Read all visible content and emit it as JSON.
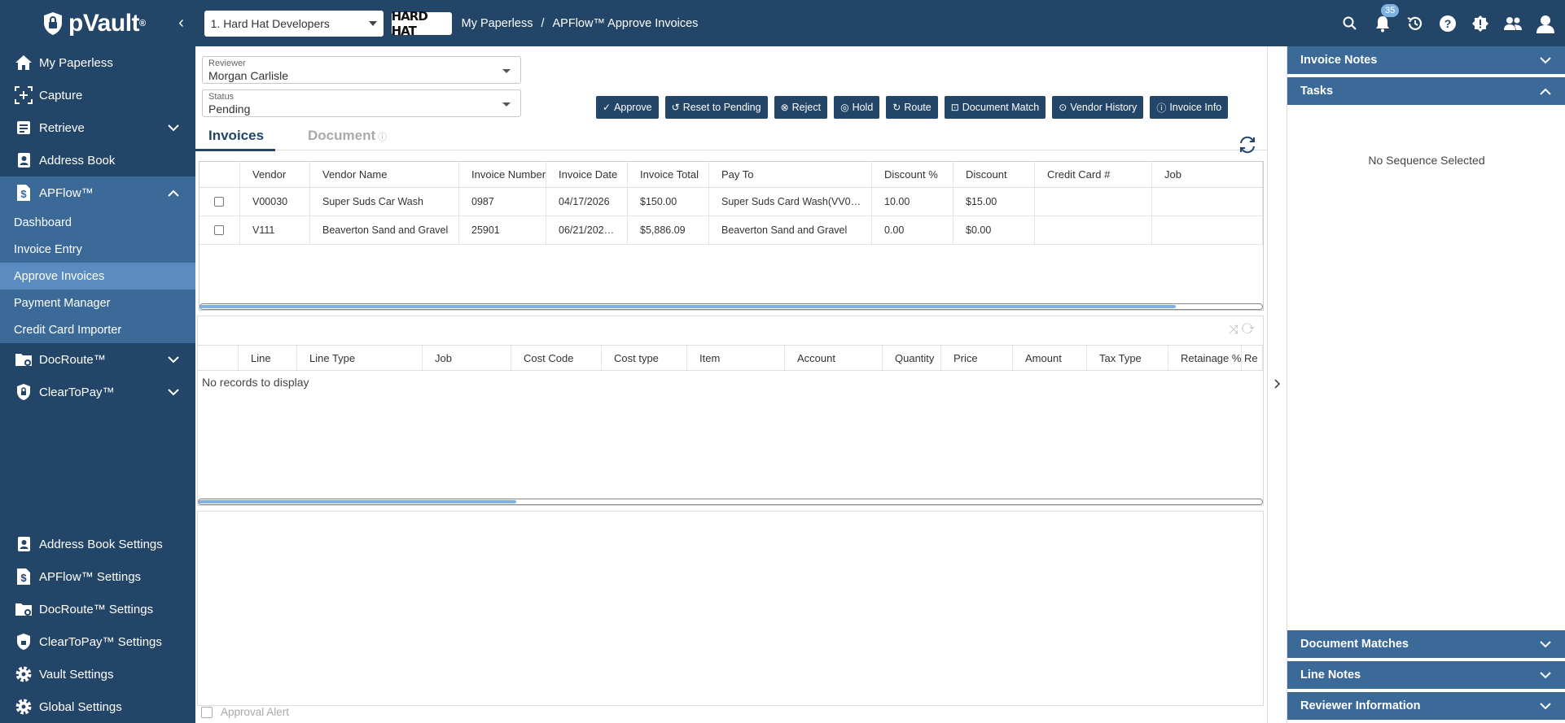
{
  "app": {
    "brand": "pVault",
    "brand_suffix": "®"
  },
  "header": {
    "company_selector": "1. Hard Hat Developers",
    "company_logo_text": "HARD HAT",
    "breadcrumb": [
      "My Paperless",
      "/",
      "APFlow™ Approve Invoices"
    ],
    "notification_count": "35"
  },
  "sidebar": {
    "items": [
      {
        "label": "My Paperless",
        "icon": "home-icon"
      },
      {
        "label": "Capture",
        "icon": "capture-icon"
      },
      {
        "label": "Retrieve",
        "icon": "retrieve-icon"
      },
      {
        "label": "Address Book",
        "icon": "address-book-icon"
      },
      {
        "label": "APFlow™",
        "icon": "dollar-doc-icon"
      }
    ],
    "apflow_sub": [
      "Dashboard",
      "Invoice Entry",
      "Approve Invoices",
      "Payment Manager",
      "Credit Card Importer"
    ],
    "items_after": [
      {
        "label": "DocRoute™",
        "icon": "folder-route-icon"
      },
      {
        "label": "ClearToPay™",
        "icon": "shield-lock-icon"
      }
    ],
    "settings": [
      {
        "label": "Address Book Settings",
        "icon": "address-book-icon"
      },
      {
        "label": "APFlow™ Settings",
        "icon": "dollar-doc-icon"
      },
      {
        "label": "DocRoute™ Settings",
        "icon": "folder-route-icon"
      },
      {
        "label": "ClearToPay™ Settings",
        "icon": "shield-lock-icon"
      },
      {
        "label": "Vault Settings",
        "icon": "gear-icon"
      },
      {
        "label": "Global Settings",
        "icon": "gear-icon"
      }
    ]
  },
  "filters": {
    "reviewer_label": "Reviewer",
    "reviewer_value": "Morgan Carlisle",
    "status_label": "Status",
    "status_value": "Pending"
  },
  "actions": [
    "Approve",
    "Reset to Pending",
    "Reject",
    "Hold",
    "Route",
    "Document Match",
    "Vendor History",
    "Invoice Info"
  ],
  "tabs": {
    "invoices": "Invoices",
    "document": "Document"
  },
  "invoice_table": {
    "columns": [
      "Vendor",
      "Vendor Name",
      "Invoice Number",
      "Invoice Date",
      "Invoice Total",
      "Pay To",
      "Discount %",
      "Discount",
      "Credit Card #",
      "Job"
    ],
    "rows": [
      [
        "V00030",
        "Super Suds Car Wash",
        "0987",
        "04/17/2026",
        "$150.00",
        "Super Suds Card Wash(VV0…",
        "10.00",
        "$15.00",
        "",
        ""
      ],
      [
        "V111",
        "Beaverton Sand and Gravel",
        "25901",
        "06/21/202…",
        "$5,886.09",
        "Beaverton Sand and Gravel",
        "0.00",
        "$0.00",
        "",
        ""
      ]
    ]
  },
  "line_table": {
    "columns": [
      "Line",
      "Line Type",
      "Job",
      "Cost Code",
      "Cost type",
      "Item",
      "Account",
      "Quantity",
      "Price",
      "Amount",
      "Tax Type",
      "Retainage %",
      "Re"
    ],
    "empty_text": "No records to display"
  },
  "approval_alert": "Approval Alert",
  "right_panel": {
    "invoice_notes": "Invoice Notes",
    "tasks": "Tasks",
    "tasks_empty": "No Sequence Selected",
    "document_matches": "Document Matches",
    "line_notes": "Line Notes",
    "reviewer_information": "Reviewer Information"
  },
  "colors": {
    "primary": "#234567",
    "secondary": "#3b6a99",
    "selected": "#5a8cc0",
    "accent": "#7fb1e0"
  }
}
